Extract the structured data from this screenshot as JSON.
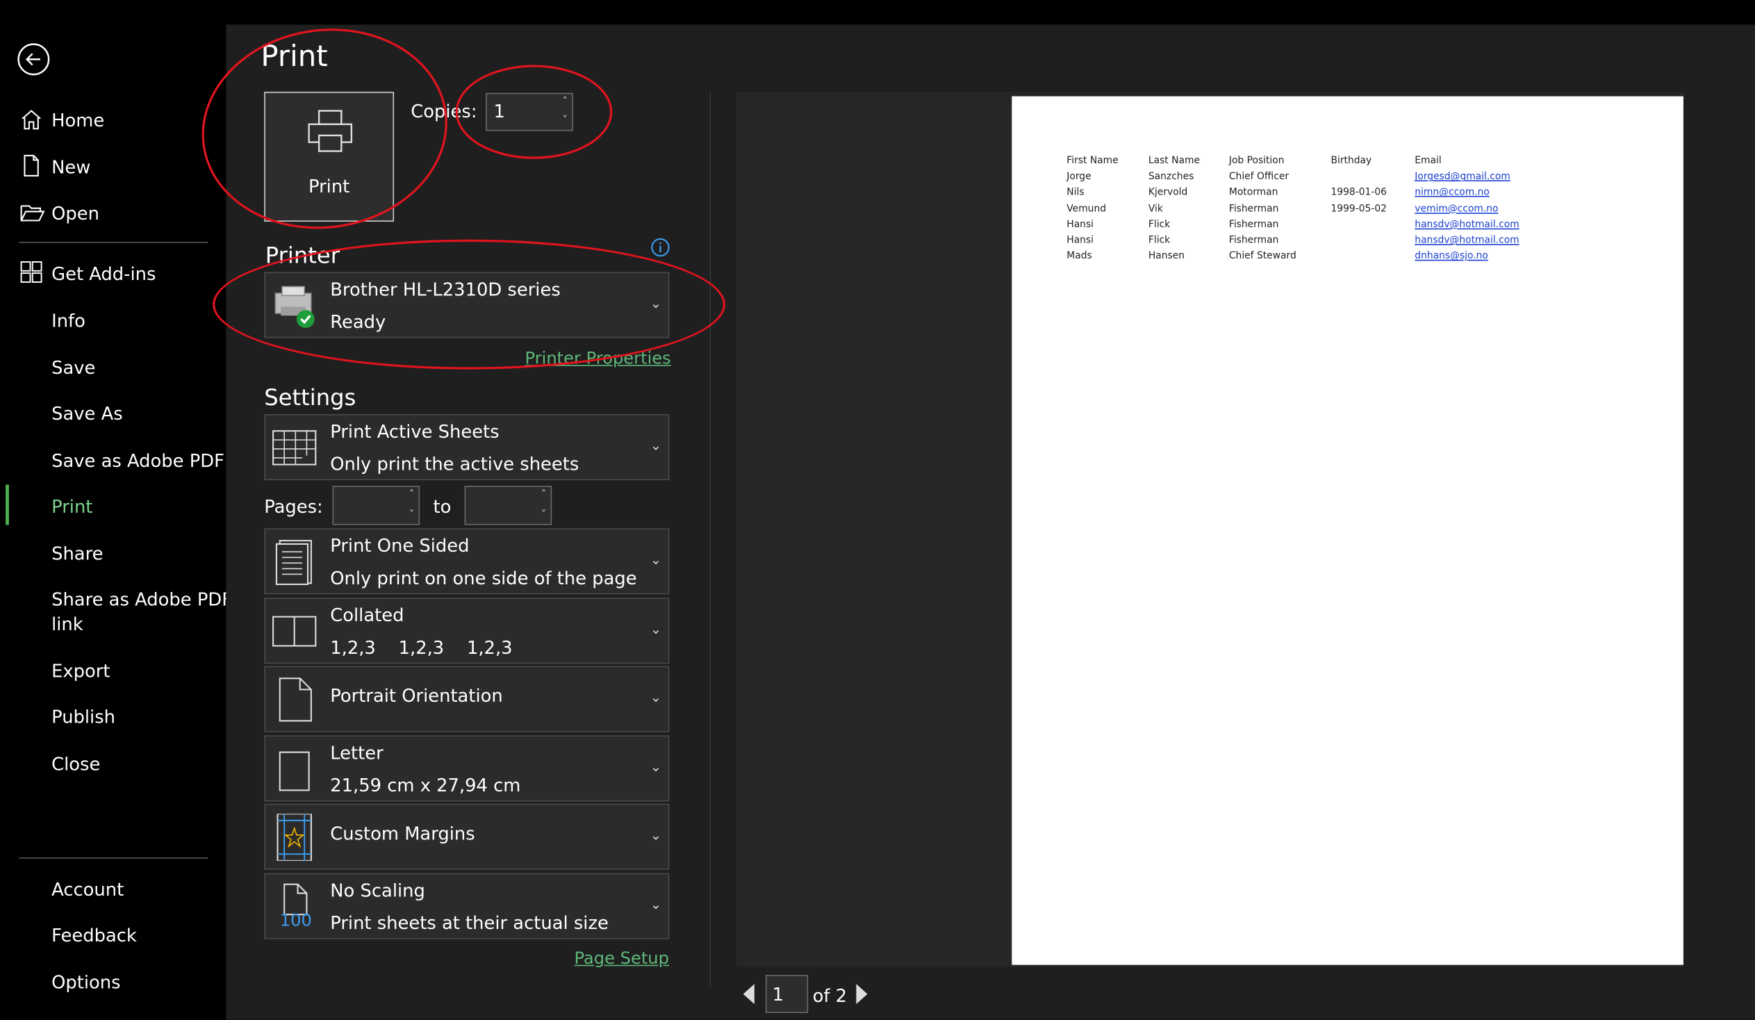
{
  "nav": {
    "items": [
      {
        "label": "Home",
        "icon": "home-icon"
      },
      {
        "label": "New",
        "icon": "new-document-icon"
      },
      {
        "label": "Open",
        "icon": "open-folder-icon"
      },
      {
        "label": "Get Add-ins",
        "icon": "add-ins-icon"
      },
      {
        "label": "Info"
      },
      {
        "label": "Save"
      },
      {
        "label": "Save As"
      },
      {
        "label": "Save as Adobe PDF"
      },
      {
        "label": "Print",
        "active": true
      },
      {
        "label": "Share"
      },
      {
        "label": "Share as Adobe PDF"
      },
      {
        "label": "link"
      },
      {
        "label": "Export"
      },
      {
        "label": "Publish"
      },
      {
        "label": "Close"
      },
      {
        "label": "Account"
      },
      {
        "label": "Feedback"
      },
      {
        "label": "Options"
      }
    ]
  },
  "print": {
    "title": "Print",
    "button_label": "Print",
    "copies_label": "Copies:",
    "copies_value": "1"
  },
  "printer": {
    "heading": "Printer",
    "name": "Brother HL-L2310D series",
    "status": "Ready",
    "properties_link": "Printer Properties",
    "info_icon": "info-icon"
  },
  "settings": {
    "heading": "Settings",
    "what": {
      "title": "Print Active Sheets",
      "subtitle": "Only print the active sheets"
    },
    "pages_label": "Pages:",
    "pages_to": "to",
    "sides": {
      "title": "Print One Sided",
      "subtitle": "Only print on one side of the page"
    },
    "collation": {
      "title": "Collated",
      "subtitle": "1,2,3    1,2,3    1,2,3"
    },
    "orientation": {
      "title": "Portrait Orientation"
    },
    "paper": {
      "title": "Letter",
      "subtitle": "21,59 cm x 27,94 cm"
    },
    "margins": {
      "title": "Custom Margins"
    },
    "scaling": {
      "title": "No Scaling",
      "subtitle": "Print sheets at their actual size",
      "icon_text": "100"
    },
    "page_setup_link": "Page Setup"
  },
  "preview": {
    "headers": [
      "First Name",
      "Last Name",
      "Job Position",
      "Birthday",
      "Email"
    ],
    "rows": [
      [
        "Jorge",
        "Sanzches",
        "Chief Officer",
        "",
        "Jorgesd@gmail.com"
      ],
      [
        "Nils",
        "Kjervold",
        "Motorman",
        "1998-01-06",
        "nimn@ccom.no"
      ],
      [
        "Vemund",
        "Vik",
        "Fisherman",
        "1999-05-02",
        "vemim@ccom.no"
      ],
      [
        "Hansi",
        "Flick",
        "Fisherman",
        "",
        "hansdv@hotmail.com"
      ],
      [
        "Hansi",
        "Flick",
        "Fisherman",
        "",
        "hansdv@hotmail.com"
      ],
      [
        "Mads",
        "Hansen",
        "Chief Steward",
        "",
        "dnhans@sjo.no"
      ]
    ],
    "page_current": "1",
    "page_total": "of 2"
  },
  "colors": {
    "accent": "#5fb87a",
    "annotation": "#e0141e",
    "panel": "#1f1f1f"
  }
}
